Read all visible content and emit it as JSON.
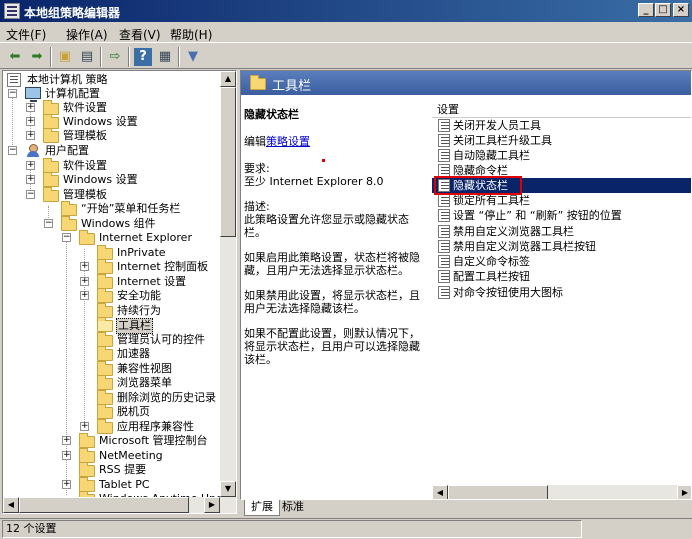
{
  "window": {
    "title": "本地组策略编辑器",
    "buttons": {
      "minimize": "_",
      "maximize": "□",
      "close": "×"
    }
  },
  "menu": [
    "文件(F)",
    "操作(A)",
    "查看(V)",
    "帮助(H)"
  ],
  "toolbar": {
    "icons": [
      "back-arrow-icon",
      "forward-arrow-icon",
      "up-folder-icon",
      "show-tree-icon",
      "export-list-icon",
      "help-icon",
      "properties-icon",
      "filter-icon"
    ]
  },
  "tree": {
    "root": "本地计算机 策略",
    "computer": "计算机配置",
    "c_software": "软件设置",
    "c_windows": "Windows 设置",
    "c_admin": "管理模板",
    "user": "用户配置",
    "u_software": "软件设置",
    "u_windows": "Windows 设置",
    "u_admin": "管理模板",
    "start_menu": "“开始”菜单和任务栏",
    "win_components": "Windows 组件",
    "ie": "Internet Explorer",
    "inprivate": "InPrivate",
    "ie_control_panel": "Internet 控制面板",
    "ie_settings": "Internet 设置",
    "security": "安全功能",
    "persistence": "持续行为",
    "toolbars": "工具栏",
    "admin_approved": "管理员认可的控件",
    "accelerators": "加速器",
    "compat_view": "兼容性视图",
    "browser_menus": "浏览器菜单",
    "delete_history": "删除浏览的历史记录",
    "offline": "脱机页",
    "app_compat": "应用程序兼容性",
    "mmc": "Microsoft 管理控制台",
    "netmeeting": "NetMeeting",
    "rss": "RSS 提要",
    "tablet": "Tablet PC",
    "anytime_upgrade": "Windows Anytime Upgrade"
  },
  "header": {
    "title": "工具栏"
  },
  "description": {
    "policy_title": "隐藏状态栏",
    "edit_prefix": "编辑",
    "edit_link": "策略设置",
    "req_label": "要求:",
    "req_value": "至少 Internet Explorer 8.0",
    "desc_label": "描述:",
    "desc_1": "此策略设置允许您显示或隐藏状态栏。",
    "desc_2": "如果启用此策略设置，状态栏将被隐藏，且用户无法选择显示状态栏。",
    "desc_3": "如果禁用此设置，将显示状态栏，且用户无法选择隐藏该栏。",
    "desc_4": "如果不配置此设置，则默认情况下，将显示状态栏，且用户可以选择隐藏该栏。"
  },
  "list": {
    "header": "设置",
    "items": [
      "关闭开发人员工具",
      "关闭工具栏升级工具",
      "自动隐藏工具栏",
      "隐藏命令栏",
      "隐藏状态栏",
      "锁定所有工具栏",
      "设置 “停止” 和 “刷新” 按钮的位置",
      "禁用自定义浏览器工具栏",
      "禁用自定义浏览器工具栏按钮",
      "自定义命令标签",
      "配置工具栏按钮",
      "对命令按钮使用大图标"
    ],
    "selected_index": 4
  },
  "tabs": [
    "扩展",
    "标准"
  ],
  "status": {
    "text": "12 个设置"
  },
  "colors": {
    "selection": "#0a246a",
    "highlight_box": "#e00000",
    "header_band": "#4a6eb0"
  }
}
